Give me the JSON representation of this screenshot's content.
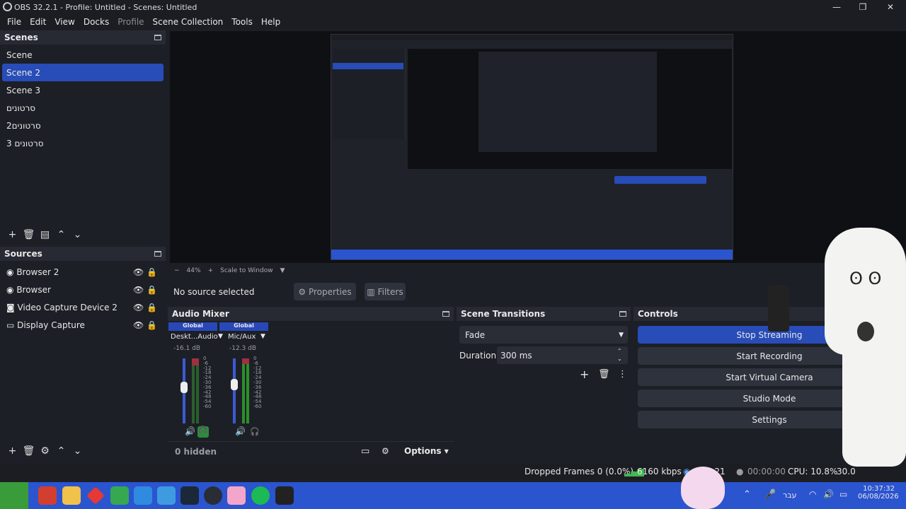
{
  "window": {
    "title": "OBS 32.2.1 - Profile: Untitled - Scenes: Untitled"
  },
  "menu": [
    "File",
    "Edit",
    "View",
    "Docks",
    "Profile",
    "Scene Collection",
    "Tools",
    "Help"
  ],
  "scenes": {
    "title": "Scenes",
    "items": [
      "Scene",
      "Scene 2",
      "Scene 3",
      "סרטונים",
      "סרטונים2",
      "סרטונים 3"
    ],
    "selected": "Scene 2"
  },
  "sources": {
    "title": "Sources",
    "items": [
      {
        "name": "Browser 2",
        "icon": "globe-icon"
      },
      {
        "name": "Browser",
        "icon": "globe-icon"
      },
      {
        "name": "Video Capture Device 2",
        "icon": "camera-icon"
      },
      {
        "name": "Display Capture",
        "icon": "monitor-icon"
      }
    ]
  },
  "preview_bar": {
    "zoom": "44%",
    "scale_mode": "Scale to Window"
  },
  "context_bar": {
    "status": "No source selected",
    "properties": "Properties",
    "filters": "Filters"
  },
  "audio_mixer": {
    "title": "Audio Mixer",
    "channels": [
      {
        "group": "Global",
        "name": "Deskt...Audio",
        "db": "-16.1 dB",
        "level": 0.56
      },
      {
        "group": "Global",
        "name": "Mic/Aux",
        "db": "-12.3 dB",
        "level": 0.62
      }
    ],
    "scale": [
      "0",
      "-6",
      "-12",
      "-18",
      "-24",
      "-30",
      "-36",
      "-42",
      "-48",
      "-54",
      "-60"
    ],
    "hidden": "0 hidden",
    "options": "Options"
  },
  "scene_transitions": {
    "title": "Scene Transitions",
    "transition": "Fade",
    "duration_label": "Duration",
    "duration": "300 ms"
  },
  "controls": {
    "title": "Controls",
    "buttons": [
      "Stop Streaming",
      "Start Recording",
      "Start Virtual Camera",
      "Studio Mode",
      "Settings"
    ]
  },
  "status_bar": {
    "dropped": "Dropped Frames 0 (0.0%)",
    "bitrate": "6160 kbps",
    "stream_time": "04:21",
    "rec_time": "00:00:00",
    "cpu": "CPU: 10.8%",
    "fps": "30.0"
  },
  "taskbar": {
    "lang": "עבר",
    "time": "10:37:32",
    "date": "06/08/2026",
    "accent": "#2b54cf"
  }
}
